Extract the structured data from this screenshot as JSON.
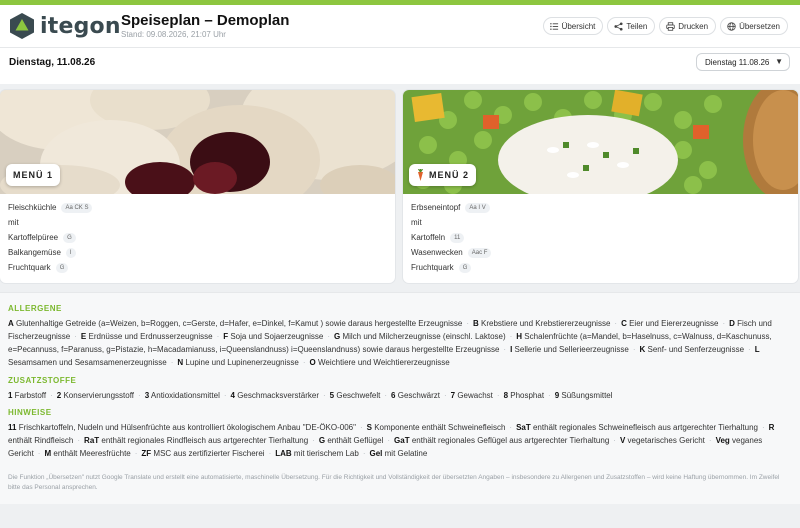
{
  "app": {
    "logo_text": "itegon",
    "title": "Speiseplan – Demoplan",
    "subtitle": "Stand: 09.08.2026, 21:07 Uhr"
  },
  "toolbar": {
    "overview": "Übersicht",
    "share": "Teilen",
    "print": "Drucken",
    "translate": "Übersetzen"
  },
  "day": {
    "label": "Dienstag, 11.08.26",
    "select_value": "Dienstag 11.08.26"
  },
  "menus": [
    {
      "badge": "MENÜ 1",
      "dishes": [
        {
          "name": "Fleischküchle",
          "tag": "Aa CK S"
        },
        {
          "name": "mit",
          "tag": ""
        },
        {
          "name": "Kartoffelpüree",
          "tag": "G"
        },
        {
          "name": "Balkangemüse",
          "tag": "I"
        },
        {
          "name": "Fruchtquark",
          "tag": "G"
        }
      ]
    },
    {
      "badge": "MENÜ 2",
      "dishes": [
        {
          "name": "Erbseneintopf",
          "tag": "Aa I V"
        },
        {
          "name": "mit",
          "tag": ""
        },
        {
          "name": "Kartoffeln",
          "tag": "11"
        },
        {
          "name": "Wasenwecken",
          "tag": "Aac F"
        },
        {
          "name": "Fruchtquark",
          "tag": "G"
        }
      ]
    }
  ],
  "allergens": {
    "title": "ALLERGENE",
    "items": [
      {
        "code": "A",
        "text": "Glutenhaltige Getreide (a=Weizen, b=Roggen, c=Gerste, d=Hafer, e=Dinkel, f=Kamut ) sowie daraus hergestellte Erzeugnisse"
      },
      {
        "code": "B",
        "text": "Krebstiere und Krebstiererzeugnisse"
      },
      {
        "code": "C",
        "text": "Eier und Eiererzeugnisse"
      },
      {
        "code": "D",
        "text": "Fisch und Fischerzeugnisse"
      },
      {
        "code": "E",
        "text": "Erdnüsse und Erdnusserzeugnisse"
      },
      {
        "code": "F",
        "text": "Soja und Sojaerzeugnisse"
      },
      {
        "code": "G",
        "text": "Milch und Milcherzeugnisse (einschl. Laktose)"
      },
      {
        "code": "H",
        "text": "Schalenfrüchte (a=Mandel, b=Haselnuss, c=Walnuss, d=Kaschunuss, e=Pecannuss, f=Paranuss, g=Pistazie, h=Macadamianuss, i=Queenslandnuss) i=Queenslandnuss) sowie daraus hergestellte Erzeugnisse"
      },
      {
        "code": "I",
        "text": "Sellerie und Sellerieerzeugnisse"
      },
      {
        "code": "K",
        "text": "Senf- und Senferzeugnisse"
      },
      {
        "code": "L",
        "text": "Sesamsamen und Sesamsamenerzeugnisse"
      },
      {
        "code": "N",
        "text": "Lupine und Lupinenerzeugnisse"
      },
      {
        "code": "O",
        "text": "Weichtiere und Weichtiererzeugnisse"
      }
    ]
  },
  "additives": {
    "title": "ZUSATZSTOFFE",
    "items": [
      {
        "code": "1",
        "text": "Farbstoff"
      },
      {
        "code": "2",
        "text": "Konservierungsstoff"
      },
      {
        "code": "3",
        "text": "Antioxidationsmittel"
      },
      {
        "code": "4",
        "text": "Geschmacksverstärker"
      },
      {
        "code": "5",
        "text": "Geschwefelt"
      },
      {
        "code": "6",
        "text": "Geschwärzt"
      },
      {
        "code": "7",
        "text": "Gewachst"
      },
      {
        "code": "8",
        "text": "Phosphat"
      },
      {
        "code": "9",
        "text": "Süßungsmittel"
      }
    ]
  },
  "notes": {
    "title": "HINWEISE",
    "items": [
      {
        "code": "11",
        "text": "Frischkartoffeln, Nudeln und Hülsenfrüchte aus kontrolliert ökologischem Anbau \"DE-ÖKO-006\""
      },
      {
        "code": "S",
        "text": "Komponente enthält Schweinefleisch"
      },
      {
        "code": "SaT",
        "text": "enthält regionales Schweinefleisch aus artgerechter Tierhaltung"
      },
      {
        "code": "R",
        "text": "enthält Rindfleisch"
      },
      {
        "code": "RaT",
        "text": "enthält regionales Rindfleisch aus artgerechter Tierhaltung"
      },
      {
        "code": "G",
        "text": "enthält Geflügel"
      },
      {
        "code": "GaT",
        "text": "enthält regionales Geflügel aus artgerechter Tierhaltung"
      },
      {
        "code": "V",
        "text": "vegetarisches Gericht"
      },
      {
        "code": "Veg",
        "text": "veganes Gericht"
      },
      {
        "code": "M",
        "text": "enthält Meeresfrüchte"
      },
      {
        "code": "ZF",
        "text": "MSC aus zertifizierter Fischerei"
      },
      {
        "code": "LAB",
        "text": "mit tierischem Lab"
      },
      {
        "code": "Gel",
        "text": "mit Gelatine"
      }
    ]
  },
  "notice": "Die Funktion „Übersetzen\" nutzt Google Translate und erstellt eine automatisierte, maschinelle Übersetzung. Für die Richtigkeit und Vollständigkeit der übersetzten Angaben – insbesondere zu Allergenen und Zusatzstoffen – wird keine Haftung übernommen. Im Zweifel bitte das Personal ansprechen.",
  "colors": {
    "accent": "#8dc63f",
    "section_title": "#7cb82f",
    "logo": "#3a4a50"
  },
  "icons": [
    "logo-hexagon-icon",
    "list-icon",
    "share-icon",
    "printer-icon",
    "globe-icon",
    "chevron-down-icon",
    "carrot-icon"
  ]
}
